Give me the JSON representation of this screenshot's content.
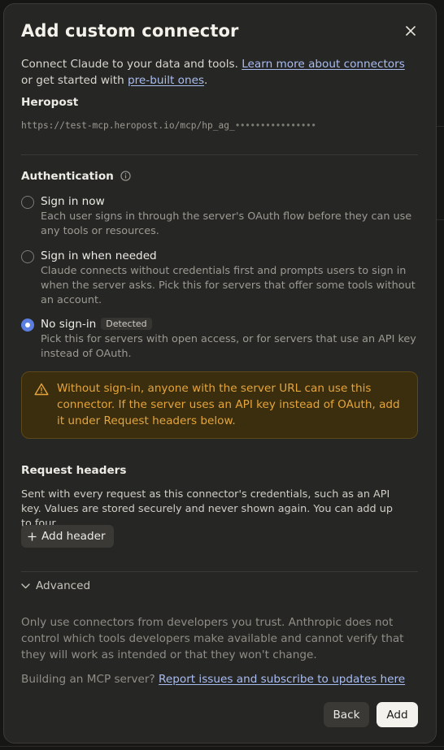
{
  "dialog": {
    "title": "Add custom connector",
    "intro_prefix": "Connect Claude to your data and tools. ",
    "intro_link1": "Learn more about connectors",
    "intro_mid": " or get started with ",
    "intro_link2": "pre-built ones",
    "intro_suffix": "."
  },
  "server": {
    "name": "Heropost",
    "url": "https://test-mcp.heropost.io/mcp/hp_ag_",
    "secret_mask": "••••••••••••••••"
  },
  "authentication": {
    "title": "Authentication",
    "options": [
      {
        "label": "Sign in now",
        "description": "Each user signs in through the server's OAuth flow before they can use any tools or resources.",
        "selected": false
      },
      {
        "label": "Sign in when needed",
        "description": "Claude connects without credentials first and prompts users to sign in when the server asks. Pick this for servers that offer some tools without an account.",
        "selected": false
      },
      {
        "label": "No sign-in",
        "badge": "Detected",
        "description": "Pick this for servers with open access, or for servers that use an API key instead of OAuth.",
        "selected": true
      }
    ],
    "warning": "Without sign-in, anyone with the server URL can use this connector. If the server uses an API key instead of OAuth, add it under Request headers below."
  },
  "request_headers": {
    "title": "Request headers",
    "description": "Sent with every request as this connector's credentials, such as an API key. Values are stored securely and never shown again. You can add up to four.",
    "add_label": "Add header"
  },
  "advanced": {
    "label": "Advanced"
  },
  "footer": {
    "disclaimer": "Only use connectors from developers you trust. Anthropic does not control which tools developers make available and cannot verify that they will work as intended or that they won't change.",
    "building_prefix": "Building an MCP server? ",
    "building_link": "Report issues and subscribe to updates here",
    "back_label": "Back",
    "add_label": "Add"
  },
  "colors": {
    "accent": "#5b7fe0",
    "link": "#a9bdf2",
    "warning_text": "#e5a43c",
    "warning_bg": "#3a2e0f"
  }
}
